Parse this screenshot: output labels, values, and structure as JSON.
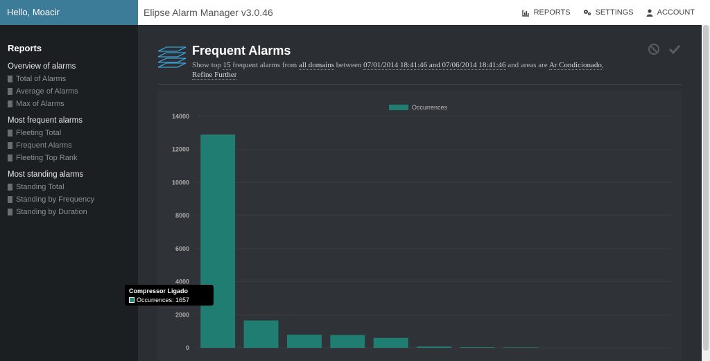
{
  "header": {
    "greeting": "Hello, Moacir",
    "app_title": "Elipse Alarm Manager v3.0.46",
    "nav": {
      "reports": "REPORTS",
      "settings": "SETTINGS",
      "account": "ACCOUNT"
    }
  },
  "sidebar": {
    "title": "Reports",
    "groups": [
      {
        "title": "Overview of alarms",
        "items": [
          "Total of Alarms",
          "Average of Alarms",
          "Max of Alarms"
        ]
      },
      {
        "title": "Most frequent alarms",
        "items": [
          "Fleeting Total",
          "Frequent Alarms",
          "Fleeting Top Rank"
        ]
      },
      {
        "title": "Most standing alarms",
        "items": [
          "Standing Total",
          "Standing by Frequency",
          "Standing by Duration"
        ]
      }
    ]
  },
  "page": {
    "title": "Frequent Alarms",
    "desc": {
      "t1": "Show top",
      "count": "15",
      "t2": "frequent alarms from",
      "domains": "all domains",
      "t3": "between",
      "range": "07/01/2014 18:41:46 and 07/06/2014 18:41:46",
      "t4": "and areas are",
      "areas": "Ar Condicionado",
      "t5": ",",
      "refine": "Refine Further"
    }
  },
  "colors": {
    "bar": "#1f7d71",
    "accent": "#3c7c99"
  },
  "icons": {
    "cancel": "ban-icon",
    "confirm": "check-icon",
    "layers": "layers-icon"
  },
  "chart_data": {
    "type": "bar",
    "legend": "Occurrences",
    "legend_position": "top-center",
    "ylim": [
      0,
      14000
    ],
    "yticks": [
      0,
      2000,
      4000,
      6000,
      8000,
      10000,
      12000,
      14000
    ],
    "grid": true,
    "values": [
      12900,
      1657,
      800,
      780,
      600,
      80,
      40,
      30,
      0,
      0,
      0
    ]
  },
  "tooltip": {
    "title": "Compressor Ligado",
    "row": "Occurrences: 1657"
  }
}
